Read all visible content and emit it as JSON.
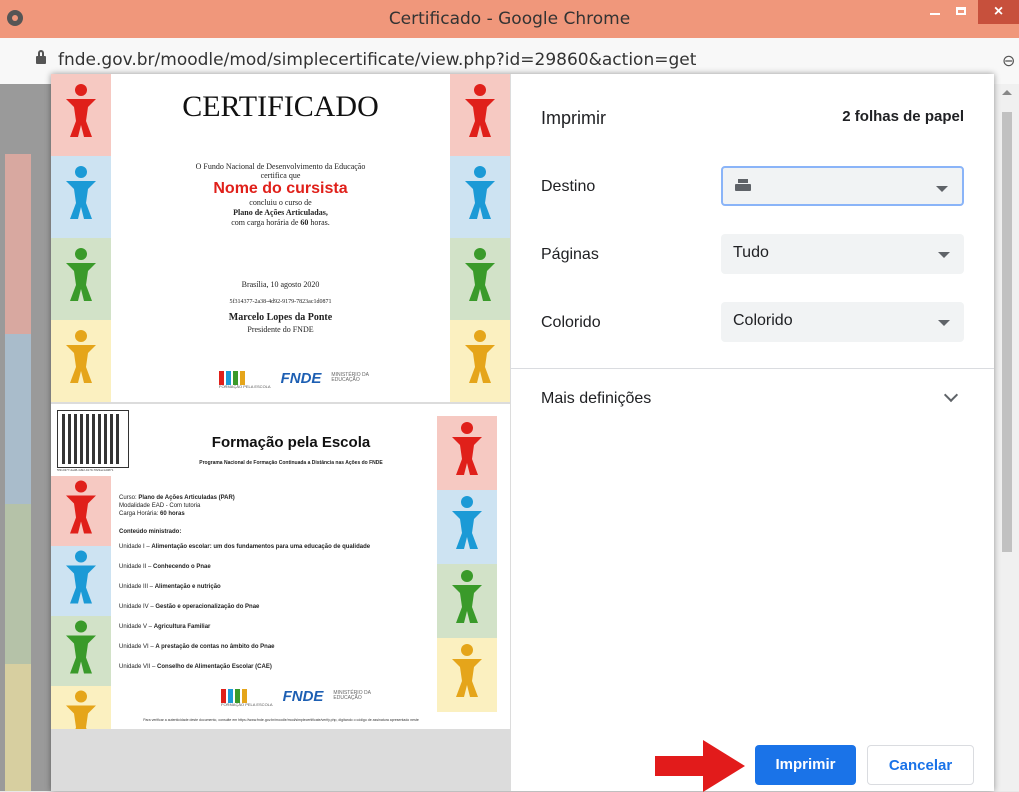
{
  "window": {
    "title": "Certificado - Google Chrome",
    "close_glyph": "×"
  },
  "address": {
    "url": "fnde.gov.br/moodle/mod/simplecertificate/view.php?id=29860&action=get",
    "zoom_glyph": "⊖"
  },
  "preview": {
    "sheet1": {
      "title": "CERTIFICADO",
      "line1": "O Fundo Nacional de Desenvolvimento da Educação",
      "line2": "certifica que",
      "name": "Nome do cursista",
      "line3": "concluiu o curso de",
      "course": "Plano de Ações Articuladas,",
      "hours_prefix": "com carga horária de ",
      "hours": "60",
      "hours_suffix": " horas.",
      "date": "Brasília, 10 agosto 2020",
      "code": "5f314377-2a38-4d92-9179-7823ac1d0871",
      "signer": "Marcelo Lopes da Ponte",
      "signer_role": "Presidente do FNDE",
      "logo_fnde": "FNDE",
      "logo_formacao": "FORMAÇÃO PELA ESCOLA",
      "logo_ministerio": "MINISTÉRIO DA EDUCAÇÃO"
    },
    "sheet2": {
      "title": "Formação pela Escola",
      "subtitle": "Programa Nacional de Formação Continuada a Distância nas Ações do FNDE",
      "qr_code_text": "5f314377-2a38-4d92-9179-7823ac1d0871",
      "curso_label": "Curso: ",
      "curso": "Plano de Ações Articuladas (PAR)",
      "modalidade": "Modalidade EAD - Com tutoria",
      "carga_label": "Carga Horária: ",
      "carga": "60 horas",
      "conteudo": "Conteúdo ministrado:",
      "units": [
        {
          "label": "Unidade I – ",
          "text": "Alimentação escolar: um dos fundamentos para uma educação de qualidade"
        },
        {
          "label": "Unidade II – ",
          "text": "Conhecendo o Pnae"
        },
        {
          "label": "Unidade III – ",
          "text": "Alimentação e nutrição"
        },
        {
          "label": "Unidade IV – ",
          "text": "Gestão e operacionalização do Pnae"
        },
        {
          "label": "Unidade V – ",
          "text": "Agricultura Familiar"
        },
        {
          "label": "Unidade VI – ",
          "text": "A prestação de contas no âmbito do Pnae"
        },
        {
          "label": "Unidade VII – ",
          "text": "Conselho de Alimentação Escolar (CAE)"
        }
      ],
      "footer": "Para verificar a autenticidade deste documento, consulte em https://www.fnde.gov.br/moodle/mod/simplecertificate/verify.php, digitando o código de assinatura apresentado neste",
      "logo_fnde": "FNDE",
      "logo_formacao": "FORMAÇÃO PELA ESCOLA",
      "logo_ministerio": "MINISTÉRIO DA EDUCAÇÃO"
    },
    "figure_colors": [
      "#e0201a",
      "#1b9ad6",
      "#3a9a2a",
      "#e5a51a"
    ],
    "cell_bg": [
      "#f6c9c2",
      "#cde3f2",
      "#d2e2c8",
      "#fbf0c0"
    ]
  },
  "print": {
    "heading": "Imprimir",
    "sheets": "2 folhas de papel",
    "destino_label": "Destino",
    "destino_value": "",
    "paginas_label": "Páginas",
    "paginas_value": "Tudo",
    "colorido_label": "Colorido",
    "colorido_value": "Colorido",
    "mais": "Mais definições",
    "print_button": "Imprimir",
    "cancel_button": "Cancelar"
  },
  "colors": {
    "accent": "#1a73e8",
    "titlebar": "#f0977b",
    "arrow": "#e21b1b"
  }
}
